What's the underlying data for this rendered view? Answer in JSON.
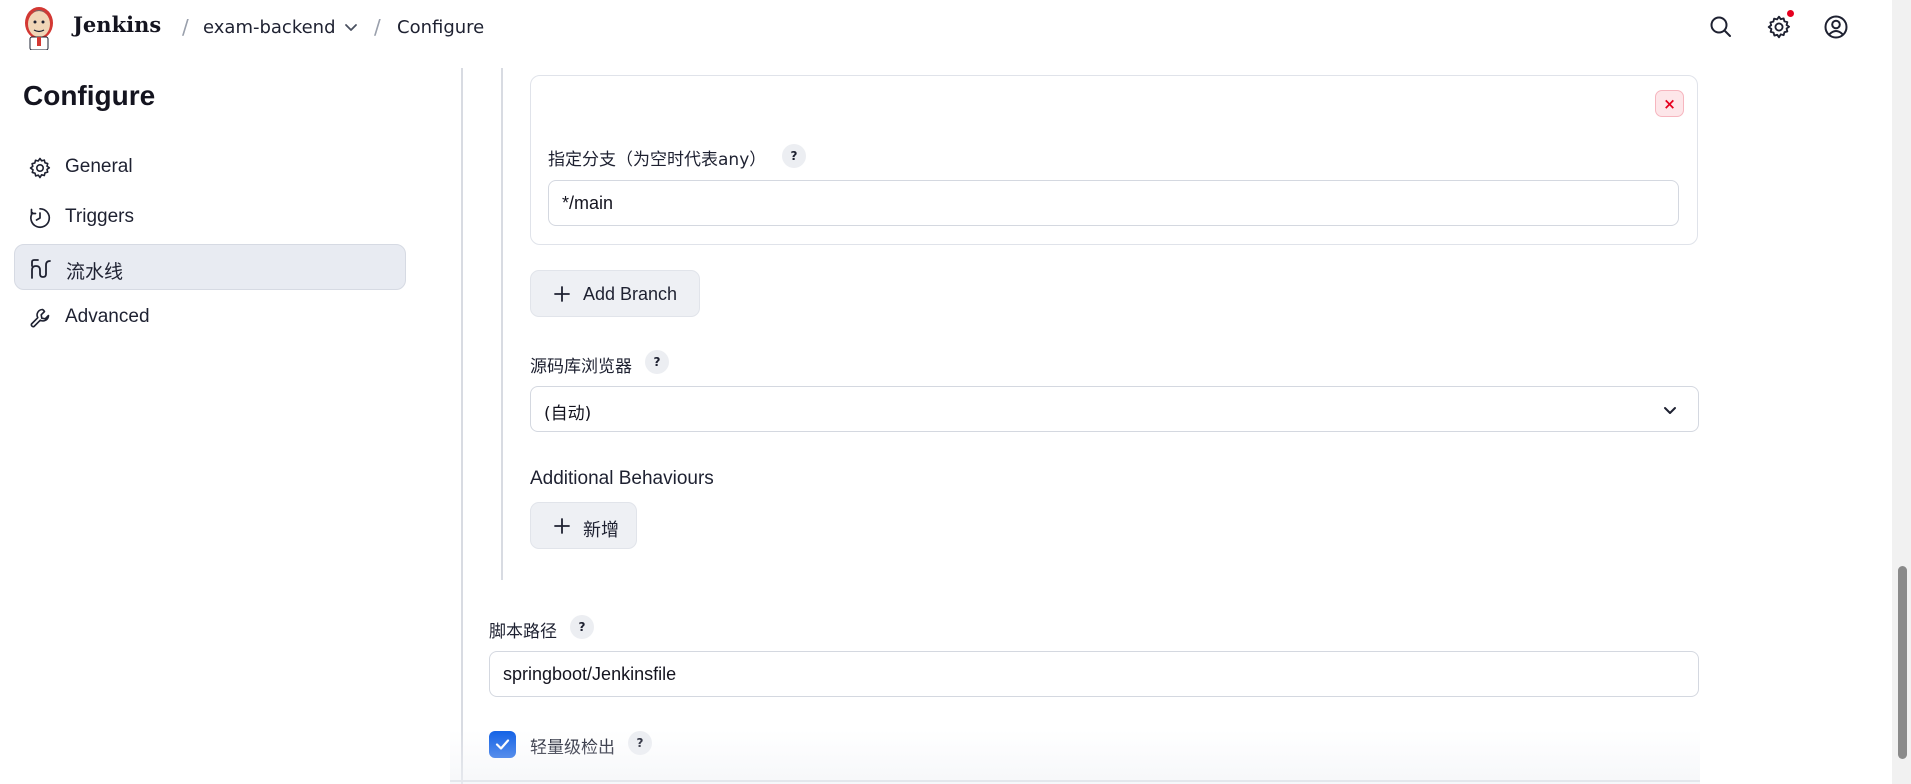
{
  "header": {
    "brand": "Jenkins",
    "breadcrumb": {
      "separator": "/",
      "job": "exam-backend",
      "current": "Configure"
    },
    "icons": [
      "search-icon",
      "gear-icon",
      "user-icon"
    ],
    "notification_color": "#e6001f"
  },
  "sidebar": {
    "title": "Configure",
    "items": [
      {
        "label": "General",
        "icon": "gear-icon",
        "active": false
      },
      {
        "label": "Triggers",
        "icon": "clock-icon",
        "active": false
      },
      {
        "label": "流水线",
        "icon": "pipeline-icon",
        "active": true
      },
      {
        "label": "Advanced",
        "icon": "wrench-icon",
        "active": false
      }
    ]
  },
  "branch_section": {
    "delete_label": "×",
    "branch_label": "指定分支（为空时代表any）",
    "help": "?",
    "branch_value": "*/main",
    "add_branch_label": "Add Branch"
  },
  "repo_browser": {
    "label": "源码库浏览器",
    "help": "?",
    "selected": "(自动)"
  },
  "behaviours": {
    "label": "Additional Behaviours",
    "add_label": "新增"
  },
  "script_path": {
    "label": "脚本路径",
    "help": "?",
    "value": "springboot/Jenkinsfile"
  },
  "lightweight": {
    "label": "轻量级检出",
    "help": "?",
    "checked": true
  },
  "colors": {
    "accent": "#1261e6",
    "danger": "#e6001f",
    "active_bg": "#e8ebf2"
  }
}
